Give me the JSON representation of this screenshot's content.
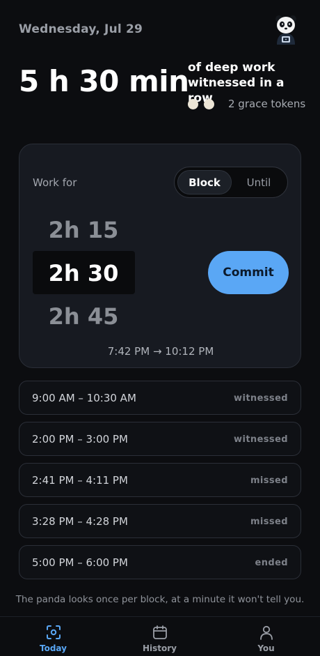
{
  "header": {
    "date": "Wednesday, Jul 29",
    "avatar_icon": "panda-avatar-icon"
  },
  "streak": {
    "duration": "5 h 30 min",
    "caption": "of deep work witnessed in a row",
    "grace_tokens_count": 2,
    "grace_tokens_label": "2 grace tokens",
    "token_color": "#ece5d6"
  },
  "work_card": {
    "label": "Work for",
    "mode_options": [
      "Block",
      "Until"
    ],
    "selected_mode": "Block",
    "picker": {
      "previous": "2h 15",
      "selected": "2h 30",
      "next": "2h 45"
    },
    "commit_label": "Commit",
    "commit_color": "#5aa7f5",
    "time_range": "7:42 PM → 10:12 PM"
  },
  "blocks": [
    {
      "time": "9:00 AM – 10:30 AM",
      "status": "witnessed"
    },
    {
      "time": "2:00 PM – 3:00 PM",
      "status": "witnessed"
    },
    {
      "time": "2:41 PM – 4:11 PM",
      "status": "missed"
    },
    {
      "time": "3:28 PM – 4:28 PM",
      "status": "missed"
    },
    {
      "time": "5:00 PM – 6:00 PM",
      "status": "ended"
    }
  ],
  "footnote": "The panda looks once per block, at a minute it won't tell you.",
  "nav": {
    "items": [
      {
        "label": "Today",
        "icon": "focus-scan-icon",
        "active": true
      },
      {
        "label": "History",
        "icon": "calendar-icon",
        "active": false
      },
      {
        "label": "You",
        "icon": "person-icon",
        "active": false
      }
    ],
    "active_color": "#5aa7f5",
    "inactive_color": "#9a9ea6"
  }
}
